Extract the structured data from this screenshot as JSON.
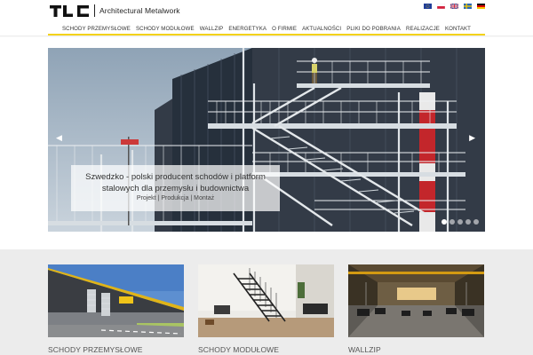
{
  "header": {
    "logo_mark": "TLC",
    "logo_text": "Architectural Metalwork",
    "languages": [
      "en",
      "pl",
      "en-gb",
      "sv",
      "de"
    ]
  },
  "nav": {
    "items": [
      "SCHODY PRZEMYSŁOWE",
      "SCHODY MODUŁOWE",
      "WALLZIP",
      "ENERGETYKA",
      "O FIRMIE",
      "AKTUALNOŚCI",
      "PLIKI DO POBRANIA",
      "REALIZACJE",
      "KONTAKT"
    ]
  },
  "slider": {
    "caption_title": "Szwedzko - polski producent schodów i platform stalowych dla przemysłu i budownictwa",
    "caption_sub": "Projekt | Produkcja | Montaż",
    "arrow_left": "◀",
    "arrow_right": "▶",
    "slide_count": 5,
    "active_slide": 1
  },
  "cards": [
    {
      "title": "SCHODY PRZEMYSŁOWE"
    },
    {
      "title": "SCHODY MODUŁOWE"
    },
    {
      "title": "WALLZIP"
    }
  ],
  "colors": {
    "accent": "#f3d21a",
    "band": "#ececec",
    "text": "#333333"
  }
}
